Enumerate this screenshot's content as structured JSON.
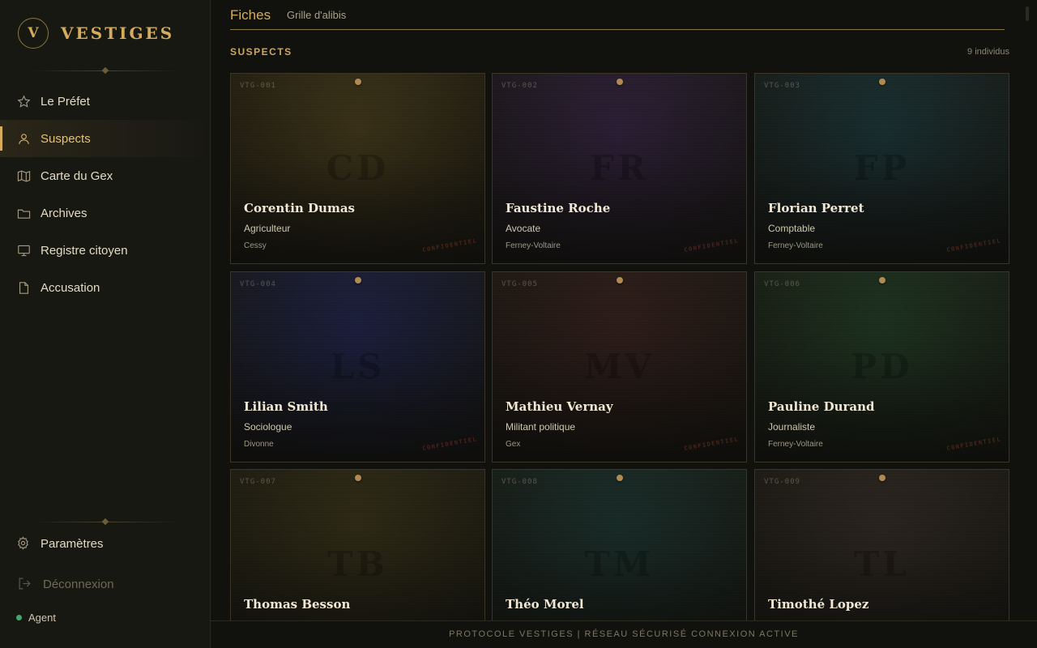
{
  "brand": {
    "mark": "V",
    "name": "VESTIGES"
  },
  "nav": [
    {
      "label": "Le Préfet",
      "icon": "star-icon"
    },
    {
      "label": "Suspects",
      "icon": "user-icon",
      "active": true
    },
    {
      "label": "Carte du Gex",
      "icon": "map-icon"
    },
    {
      "label": "Archives",
      "icon": "folder-icon"
    },
    {
      "label": "Registre citoyen",
      "icon": "monitor-icon"
    },
    {
      "label": "Accusation",
      "icon": "document-icon"
    }
  ],
  "settings_label": "Paramètres",
  "logout_label": "Déconnexion",
  "agent_label": "Agent",
  "tabs": {
    "fiches": "Fiches",
    "grille": "Grille d'alibis"
  },
  "section": {
    "title": "SUSPECTS",
    "count": "9 individus"
  },
  "stamp": "CONFIDENTIEL",
  "suspects": [
    {
      "code": "VTG-001",
      "initials": "CD",
      "name": "Corentin Dumas",
      "role": "Agriculteur",
      "city": "Cessy",
      "color": "#3d3418"
    },
    {
      "code": "VTG-002",
      "initials": "FR",
      "name": "Faustine Roche",
      "role": "Avocate",
      "city": "Ferney-Voltaire",
      "color": "#2d2038"
    },
    {
      "code": "VTG-003",
      "initials": "FP",
      "name": "Florian Perret",
      "role": "Comptable",
      "city": "Ferney-Voltaire",
      "color": "#1a3032"
    },
    {
      "code": "VTG-004",
      "initials": "LS",
      "name": "Lilian Smith",
      "role": "Sociologue",
      "city": "Divonne",
      "color": "#1c2040"
    },
    {
      "code": "VTG-005",
      "initials": "MV",
      "name": "Mathieu Vernay",
      "role": "Militant politique",
      "city": "Gex",
      "color": "#301e1a"
    },
    {
      "code": "VTG-006",
      "initials": "PD",
      "name": "Pauline Durand",
      "role": "Journaliste",
      "city": "Ferney-Voltaire",
      "color": "#1e3420"
    },
    {
      "code": "VTG-007",
      "initials": "TB",
      "name": "Thomas Besson",
      "role": "",
      "city": "",
      "color": "#302c16"
    },
    {
      "code": "VTG-008",
      "initials": "TM",
      "name": "Théo Morel",
      "role": "",
      "city": "",
      "color": "#1a2e2a"
    },
    {
      "code": "VTG-009",
      "initials": "TL",
      "name": "Timothé Lopez",
      "role": "",
      "city": "",
      "color": "#2c2620"
    }
  ],
  "footer": "PROTOCOLE VESTIGES | RÉSEAU SÉCURISÉ   CONNEXION ACTIVE"
}
